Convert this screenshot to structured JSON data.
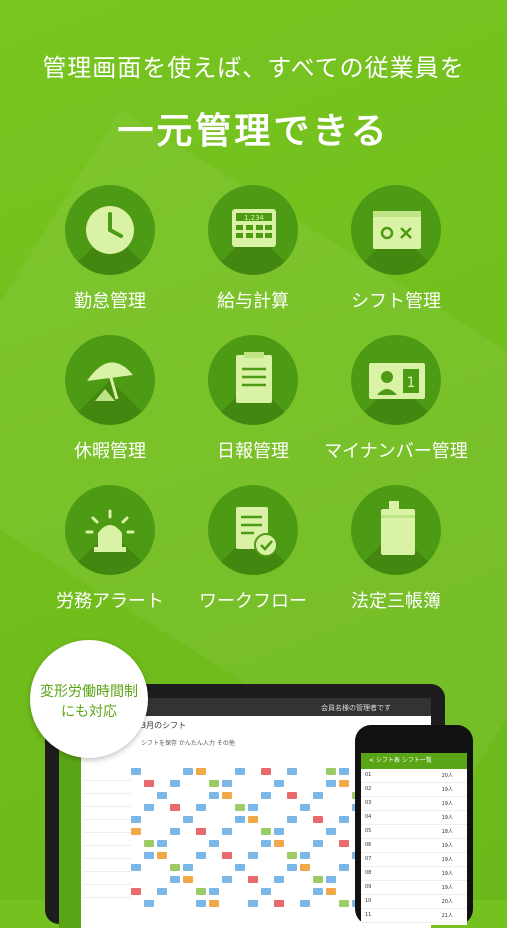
{
  "headline": {
    "sub": "管理画面を使えば、すべての従業員を",
    "main": "一元管理できる"
  },
  "features": [
    {
      "label": "勤怠管理",
      "icon": "clock-icon"
    },
    {
      "label": "給与計算",
      "icon": "calculator-icon"
    },
    {
      "label": "シフト管理",
      "icon": "calendar-icon"
    },
    {
      "label": "休暇管理",
      "icon": "umbrella-icon"
    },
    {
      "label": "日報管理",
      "icon": "clipboard-icon"
    },
    {
      "label": "マイナンバー管理",
      "icon": "id-card-icon"
    },
    {
      "label": "労務アラート",
      "icon": "alarm-icon"
    },
    {
      "label": "ワークフロー",
      "icon": "document-check-icon"
    },
    {
      "label": "法定三帳簿",
      "icon": "ledger-icon"
    }
  ],
  "badge": {
    "line1": "変形労働時間制",
    "line2": "にも対応"
  },
  "tablet": {
    "title": "3月のシフト",
    "user": "会員名様の管理者です",
    "toolbar": "シフトを保存  かんたん入力  その他",
    "calc_number": "1,234"
  },
  "phone": {
    "header": "< シフト表  シフト一覧",
    "rows": [
      {
        "time": "01",
        "count": "20人"
      },
      {
        "time": "02",
        "count": "19人"
      },
      {
        "time": "03",
        "count": "19人"
      },
      {
        "time": "04",
        "count": "19人"
      },
      {
        "time": "05",
        "count": "18人"
      },
      {
        "time": "06",
        "count": "19人"
      },
      {
        "time": "07",
        "count": "19人"
      },
      {
        "time": "08",
        "count": "19人"
      },
      {
        "time": "09",
        "count": "19人"
      },
      {
        "time": "10",
        "count": "20人"
      },
      {
        "time": "11",
        "count": "21人"
      }
    ]
  },
  "colors": {
    "background": "#74c11f",
    "circle": "#4d9a14",
    "icon": "#d9f2a6",
    "accent": "#5aa515"
  }
}
